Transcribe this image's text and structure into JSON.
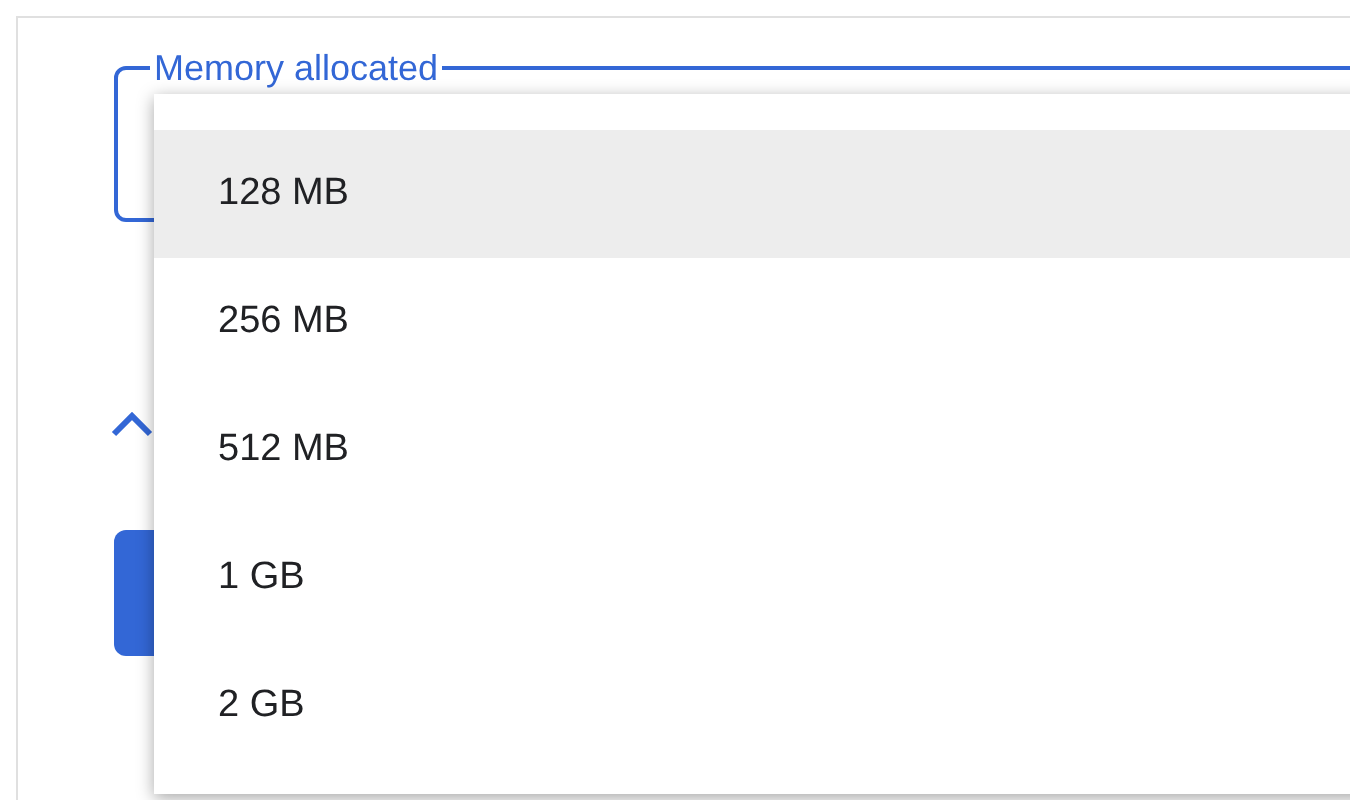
{
  "field": {
    "label": "Memory allocated"
  },
  "menu": {
    "options": [
      {
        "label": "128 MB",
        "selected": true
      },
      {
        "label": "256 MB",
        "selected": false
      },
      {
        "label": "512 MB",
        "selected": false
      },
      {
        "label": "1 GB",
        "selected": false
      },
      {
        "label": "2 GB",
        "selected": false
      }
    ]
  }
}
